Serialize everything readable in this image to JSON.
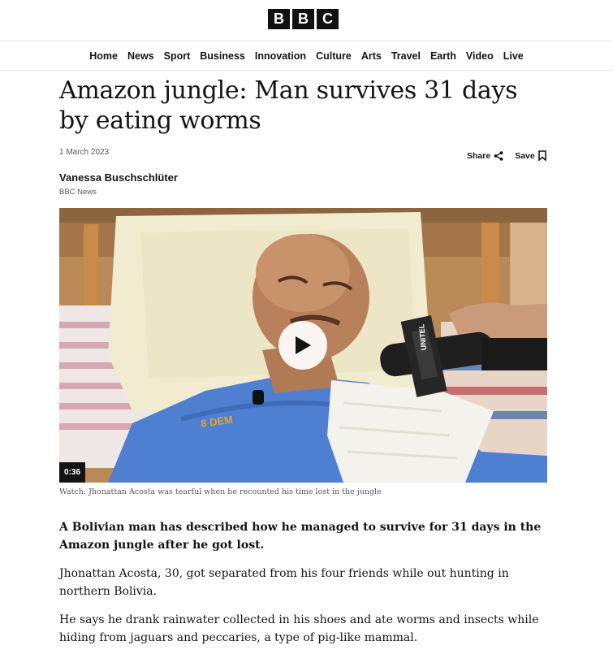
{
  "brand": {
    "letters": [
      "B",
      "B",
      "C"
    ]
  },
  "nav": {
    "items": [
      "Home",
      "News",
      "Sport",
      "Business",
      "Innovation",
      "Culture",
      "Arts",
      "Travel",
      "Earth",
      "Video",
      "Live"
    ]
  },
  "article": {
    "headline": "Amazon jungle: Man survives 31 days by eating worms",
    "date": "1 March 2023",
    "share_label": "Share",
    "save_label": "Save",
    "author": "Vanessa Buschschlüter",
    "organisation": "BBC News",
    "video": {
      "duration": "0:36",
      "caption": "Watch: Jhonattan Acosta was tearful when he recounted his time lost in the jungle",
      "mic_text": "UNITEL"
    },
    "paragraphs": [
      "A Bolivian man has described how he managed to survive for 31 days in the Amazon jungle after he got lost.",
      "Jhonattan Acosta, 30, got separated from his four friends while out hunting in northern Bolivia.",
      "He says he drank rainwater collected in his shoes and ate worms and insects while hiding from jaguars and peccaries, a type of pig-like mammal."
    ]
  }
}
